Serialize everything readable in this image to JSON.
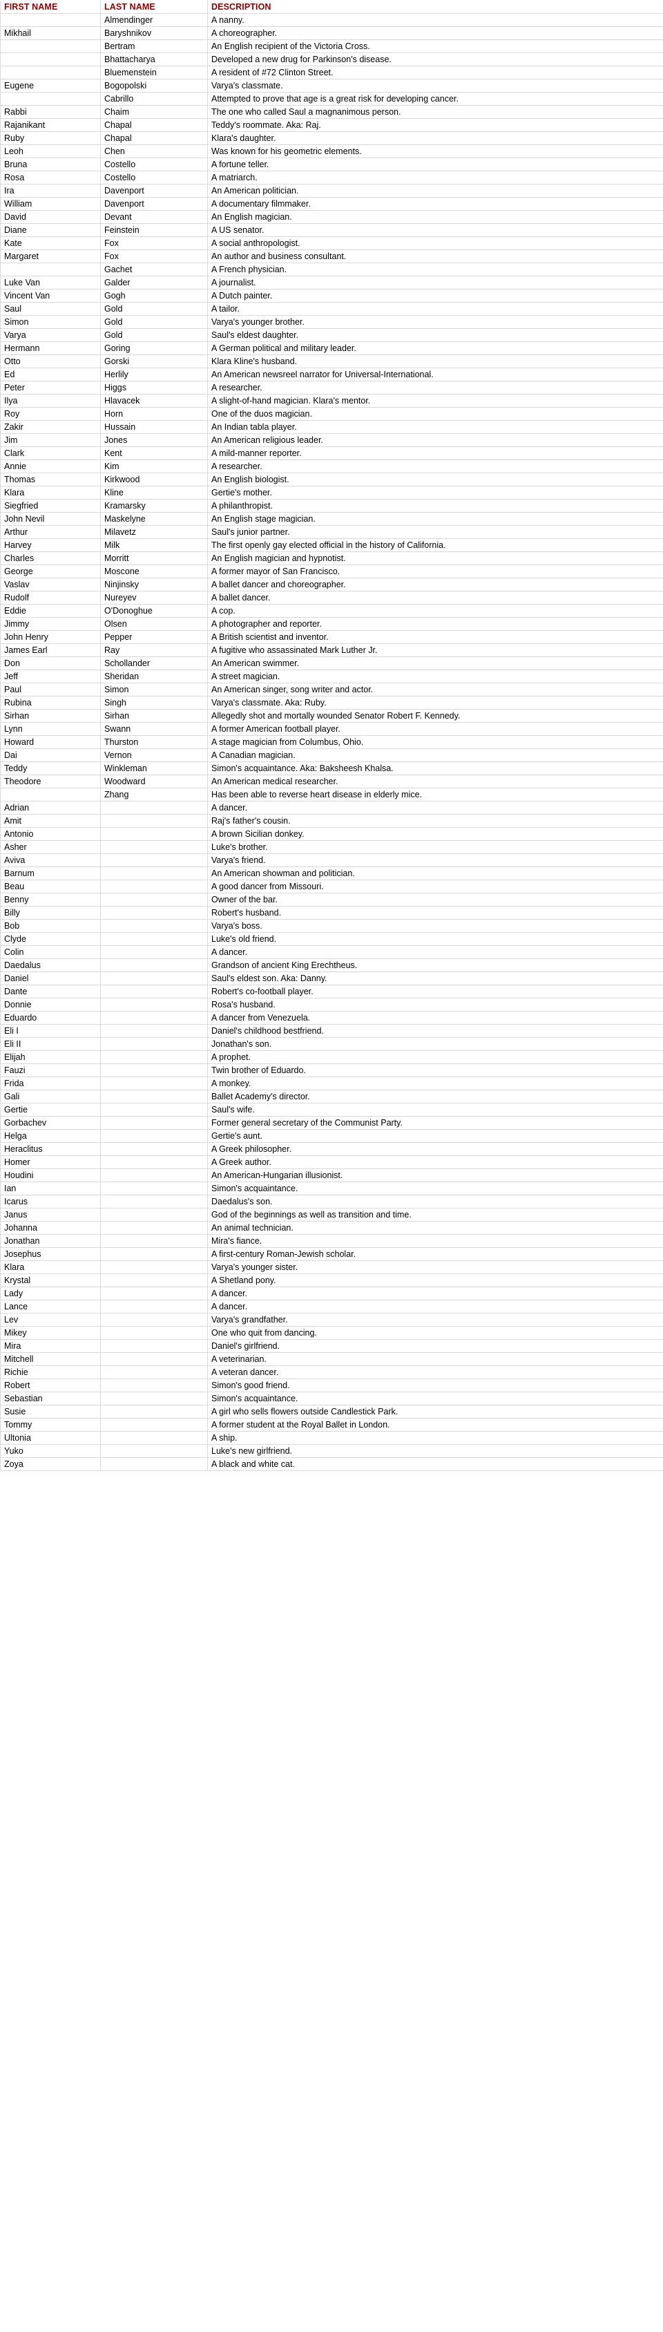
{
  "table": {
    "columns": [
      {
        "key": "first",
        "label": "FIRST NAME"
      },
      {
        "key": "last",
        "label": "LAST NAME"
      },
      {
        "key": "desc",
        "label": "DESCRIPTION"
      }
    ],
    "header_color": "#8b0000",
    "rows": [
      {
        "first": "",
        "last": "Almendinger",
        "desc": "A nanny."
      },
      {
        "first": "Mikhail",
        "last": "Baryshnikov",
        "desc": "A choreographer."
      },
      {
        "first": "",
        "last": "Bertram",
        "desc": "An English recipient of the Victoria Cross."
      },
      {
        "first": "",
        "last": "Bhattacharya",
        "desc": "Developed a new drug for Parkinson's disease."
      },
      {
        "first": "",
        "last": "Bluemenstein",
        "desc": "A resident of #72 Clinton Street."
      },
      {
        "first": "Eugene",
        "last": "Bogopolski",
        "desc": "Varya's classmate."
      },
      {
        "first": "",
        "last": "Cabrillo",
        "desc": "Attempted to prove that age is a great risk for developing cancer."
      },
      {
        "first": "Rabbi",
        "last": "Chaim",
        "desc": "The one who called Saul a magnanimous person."
      },
      {
        "first": "Rajanikant",
        "last": "Chapal",
        "desc": "Teddy's roommate. Aka: Raj."
      },
      {
        "first": "Ruby",
        "last": "Chapal",
        "desc": "Klara's daughter."
      },
      {
        "first": "Leoh",
        "last": "Chen",
        "desc": "Was known for his geometric elements."
      },
      {
        "first": "Bruna",
        "last": "Costello",
        "desc": "A fortune teller."
      },
      {
        "first": "Rosa",
        "last": "Costello",
        "desc": "A matriarch."
      },
      {
        "first": "Ira",
        "last": "Davenport",
        "desc": "An American politician."
      },
      {
        "first": "William",
        "last": "Davenport",
        "desc": "A documentary filmmaker."
      },
      {
        "first": "David",
        "last": "Devant",
        "desc": "An English magician."
      },
      {
        "first": "Diane",
        "last": "Feinstein",
        "desc": "A US senator."
      },
      {
        "first": "Kate",
        "last": "Fox",
        "desc": "A social anthropologist."
      },
      {
        "first": "Margaret",
        "last": "Fox",
        "desc": "An author and business consultant."
      },
      {
        "first": "",
        "last": "Gachet",
        "desc": "A French physician."
      },
      {
        "first": "Luke Van",
        "last": "Galder",
        "desc": "A journalist."
      },
      {
        "first": "Vincent Van",
        "last": "Gogh",
        "desc": "A Dutch painter."
      },
      {
        "first": "Saul",
        "last": "Gold",
        "desc": "A tailor."
      },
      {
        "first": "Simon",
        "last": "Gold",
        "desc": "Varya's younger brother."
      },
      {
        "first": "Varya",
        "last": "Gold",
        "desc": "Saul's eldest daughter."
      },
      {
        "first": "Hermann",
        "last": "Goring",
        "desc": "A German political and military leader."
      },
      {
        "first": "Otto",
        "last": "Gorski",
        "desc": "Klara Kline's husband."
      },
      {
        "first": "Ed",
        "last": "Herlily",
        "desc": "An American newsreel narrator for Universal-International."
      },
      {
        "first": "Peter",
        "last": "Higgs",
        "desc": "A researcher."
      },
      {
        "first": "Ilya",
        "last": "Hlavacek",
        "desc": "A slight-of-hand magician. Klara's mentor."
      },
      {
        "first": "Roy",
        "last": "Horn",
        "desc": "One of the duos magician."
      },
      {
        "first": "Zakir",
        "last": "Hussain",
        "desc": "An Indian tabla player."
      },
      {
        "first": "Jim",
        "last": "Jones",
        "desc": "An American religious leader."
      },
      {
        "first": "Clark",
        "last": "Kent",
        "desc": "A mild-manner reporter."
      },
      {
        "first": "Annie",
        "last": "Kim",
        "desc": "A researcher."
      },
      {
        "first": "Thomas",
        "last": "Kirkwood",
        "desc": "An English biologist."
      },
      {
        "first": "Klara",
        "last": "Kline",
        "desc": "Gertie's mother."
      },
      {
        "first": "Siegfried",
        "last": "Kramarsky",
        "desc": "A philanthropist."
      },
      {
        "first": " John Nevil",
        "last": "Maskelyne",
        "desc": "An English stage magician."
      },
      {
        "first": "Arthur",
        "last": "Milavetz",
        "desc": "Saul's junior partner."
      },
      {
        "first": "Harvey",
        "last": "Milk",
        "desc": "The first openly gay elected official in the history of California."
      },
      {
        "first": "Charles",
        "last": "Morritt",
        "desc": "An English magician and hypnotist."
      },
      {
        "first": "George",
        "last": "Moscone",
        "desc": "A former mayor of San Francisco."
      },
      {
        "first": "Vaslav",
        "last": "Ninjinsky",
        "desc": "A ballet dancer and choreographer."
      },
      {
        "first": "Rudolf",
        "last": "Nureyev",
        "desc": "A ballet dancer."
      },
      {
        "first": "Eddie",
        "last": "O'Donoghue",
        "desc": "A cop."
      },
      {
        "first": "Jimmy",
        "last": "Olsen",
        "desc": "A photographer and reporter."
      },
      {
        "first": "John Henry",
        "last": "Pepper",
        "desc": "A British scientist and inventor."
      },
      {
        "first": "James Earl",
        "last": "Ray",
        "desc": "A fugitive who assassinated Mark Luther Jr."
      },
      {
        "first": "Don",
        "last": "Schollander",
        "desc": "An American swimmer."
      },
      {
        "first": "Jeff",
        "last": "Sheridan",
        "desc": "A street magician."
      },
      {
        "first": "Paul",
        "last": "Simon",
        "desc": "An American singer, song writer and actor."
      },
      {
        "first": "Rubina",
        "last": "Singh",
        "desc": "Varya's classmate. Aka: Ruby."
      },
      {
        "first": "Sirhan",
        "last": "Sirhan",
        "desc": "Allegedly shot and mortally wounded Senator Robert F. Kennedy."
      },
      {
        "first": "Lynn",
        "last": "Swann",
        "desc": "A former American football player."
      },
      {
        "first": "Howard",
        "last": "Thurston",
        "desc": "A stage magician from Columbus, Ohio."
      },
      {
        "first": "Dai",
        "last": "Vernon",
        "desc": "A Canadian magician."
      },
      {
        "first": "Teddy",
        "last": "Winkleman",
        "desc": "Simon's acquaintance. Aka: Baksheesh Khalsa."
      },
      {
        "first": "Theodore",
        "last": "Woodward",
        "desc": "An American medical researcher."
      },
      {
        "first": "",
        "last": "Zhang",
        "desc": "Has been able to reverse heart disease in elderly mice."
      },
      {
        "first": "Adrian",
        "last": "",
        "desc": "A dancer."
      },
      {
        "first": "Amit",
        "last": "",
        "desc": "Raj's father's cousin."
      },
      {
        "first": "Antonio",
        "last": "",
        "desc": "A brown Sicilian donkey."
      },
      {
        "first": "Asher",
        "last": "",
        "desc": "Luke's brother."
      },
      {
        "first": "Aviva",
        "last": "",
        "desc": "Varya's friend."
      },
      {
        "first": "Barnum",
        "last": "",
        "desc": "An American showman and politician."
      },
      {
        "first": "Beau",
        "last": "",
        "desc": "A good dancer from Missouri."
      },
      {
        "first": "Benny",
        "last": "",
        "desc": "Owner of the bar."
      },
      {
        "first": "Billy",
        "last": "",
        "desc": "Robert's husband."
      },
      {
        "first": "Bob",
        "last": "",
        "desc": "Varya's boss."
      },
      {
        "first": "Clyde",
        "last": "",
        "desc": "Luke's old friend."
      },
      {
        "first": "Colin",
        "last": "",
        "desc": "A dancer."
      },
      {
        "first": "Daedalus",
        "last": "",
        "desc": "Grandson of ancient King Erechtheus."
      },
      {
        "first": "Daniel",
        "last": "",
        "desc": "Saul's eldest son. Aka: Danny."
      },
      {
        "first": "Dante",
        "last": "",
        "desc": "Robert's co-football player."
      },
      {
        "first": "Donnie",
        "last": "",
        "desc": "Rosa's husband."
      },
      {
        "first": "Eduardo",
        "last": "",
        "desc": "A dancer from Venezuela."
      },
      {
        "first": "Eli I",
        "last": "",
        "desc": "Daniel's childhood bestfriend."
      },
      {
        "first": "Eli II",
        "last": "",
        "desc": "Jonathan's son."
      },
      {
        "first": "Elijah",
        "last": "",
        "desc": "A prophet."
      },
      {
        "first": "Fauzi",
        "last": "",
        "desc": "Twin brother of Eduardo."
      },
      {
        "first": "Frida",
        "last": "",
        "desc": "A monkey."
      },
      {
        "first": "Gali",
        "last": "",
        "desc": "Ballet Academy's director."
      },
      {
        "first": "Gertie",
        "last": "",
        "desc": "Saul's wife."
      },
      {
        "first": "Gorbachev",
        "last": "",
        "desc": "Former general secretary of the Communist Party."
      },
      {
        "first": "Helga",
        "last": "",
        "desc": "Gertie's aunt."
      },
      {
        "first": "Heraclitus",
        "last": "",
        "desc": "A Greek philosopher."
      },
      {
        "first": "Homer",
        "last": "",
        "desc": "A Greek author."
      },
      {
        "first": "Houdini",
        "last": "",
        "desc": "An American-Hungarian illusionist."
      },
      {
        "first": "Ian",
        "last": "",
        "desc": "Simon's acquaintance."
      },
      {
        "first": "Icarus",
        "last": "",
        "desc": "Daedalus's son."
      },
      {
        "first": "Janus",
        "last": "",
        "desc": "God of the beginnings as well as transition and time."
      },
      {
        "first": "Johanna",
        "last": "",
        "desc": "An animal technician."
      },
      {
        "first": "Jonathan",
        "last": "",
        "desc": "Mira's fiance."
      },
      {
        "first": "Josephus",
        "last": "",
        "desc": "A first-century Roman-Jewish scholar."
      },
      {
        "first": "Klara",
        "last": "",
        "desc": "Varya's younger sister."
      },
      {
        "first": "Krystal",
        "last": "",
        "desc": "A Shetland pony."
      },
      {
        "first": "Lady",
        "last": "",
        "desc": "A dancer."
      },
      {
        "first": "Lance",
        "last": "",
        "desc": "A dancer."
      },
      {
        "first": "Lev",
        "last": "",
        "desc": "Varya's grandfather."
      },
      {
        "first": "Mikey",
        "last": "",
        "desc": "One who quit from dancing."
      },
      {
        "first": "Mira",
        "last": "",
        "desc": "Daniel's girlfriend."
      },
      {
        "first": "Mitchell",
        "last": "",
        "desc": "A veterinarian."
      },
      {
        "first": "Richie",
        "last": "",
        "desc": "A veteran dancer."
      },
      {
        "first": "Robert",
        "last": "",
        "desc": "Simon's good friend."
      },
      {
        "first": "Sebastian",
        "last": "",
        "desc": "Simon's acquaintance."
      },
      {
        "first": "Susie",
        "last": "",
        "desc": "A girl who sells flowers outside Candlestick Park."
      },
      {
        "first": "Tommy",
        "last": "",
        "desc": "A former student at the Royal Ballet in London."
      },
      {
        "first": "Ultonia",
        "last": "",
        "desc": "A ship."
      },
      {
        "first": "Yuko",
        "last": "",
        "desc": "Luke's new girlfriend."
      },
      {
        "first": "Zoya",
        "last": "",
        "desc": "A black and white cat."
      }
    ]
  }
}
